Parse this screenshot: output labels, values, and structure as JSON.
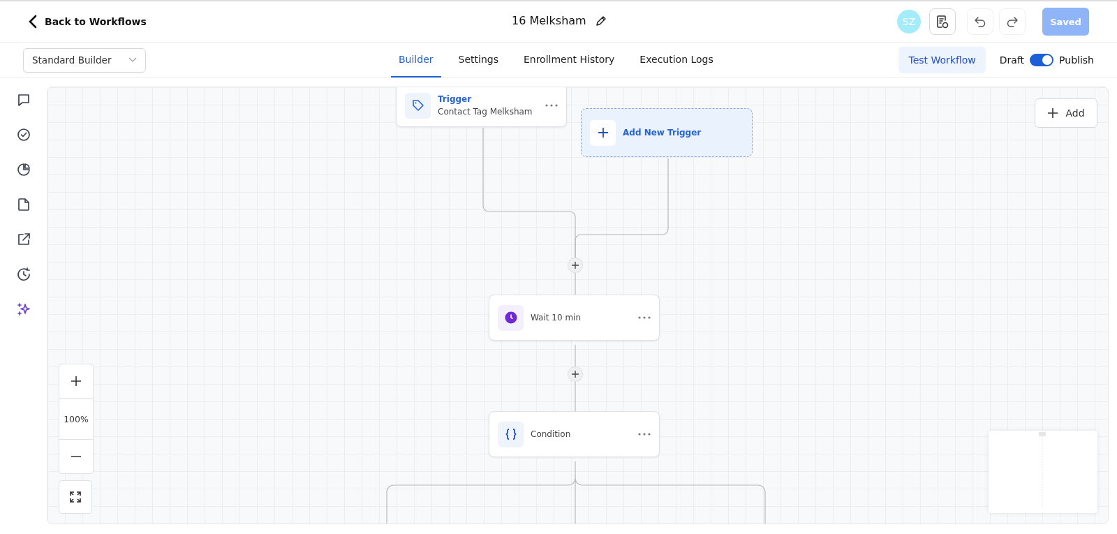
{
  "header": {
    "back_label": "Back to Workflows",
    "title": "16 Melksham",
    "avatar": "SZ",
    "save_label": "Saved"
  },
  "builder_select": {
    "value": "Standard Builder"
  },
  "tabs": [
    {
      "label": "Builder",
      "selected": true
    },
    {
      "label": "Settings",
      "selected": false
    },
    {
      "label": "Enrollment History",
      "selected": false
    },
    {
      "label": "Execution Logs",
      "selected": false
    }
  ],
  "test_button": "Test Workflow",
  "publish_toggle": {
    "off_label": "Draft",
    "on_label": "Publish",
    "on": true
  },
  "sidebar": {
    "items": [
      {
        "kind": "chat"
      },
      {
        "kind": "check"
      },
      {
        "kind": "pie"
      },
      {
        "kind": "note"
      },
      {
        "kind": "external"
      },
      {
        "kind": "history"
      },
      {
        "kind": "sparkle"
      }
    ]
  },
  "canvas": {
    "add_button": "Add",
    "add_trigger": "Add New Trigger",
    "zoom_level": "100%",
    "nodes": [
      {
        "kind": "trigger",
        "title": "Trigger",
        "subtitle": "Contact Tag Melksham"
      },
      {
        "kind": "wait",
        "title": "Wait 10 min"
      },
      {
        "kind": "condition",
        "title": "Condition"
      }
    ]
  }
}
